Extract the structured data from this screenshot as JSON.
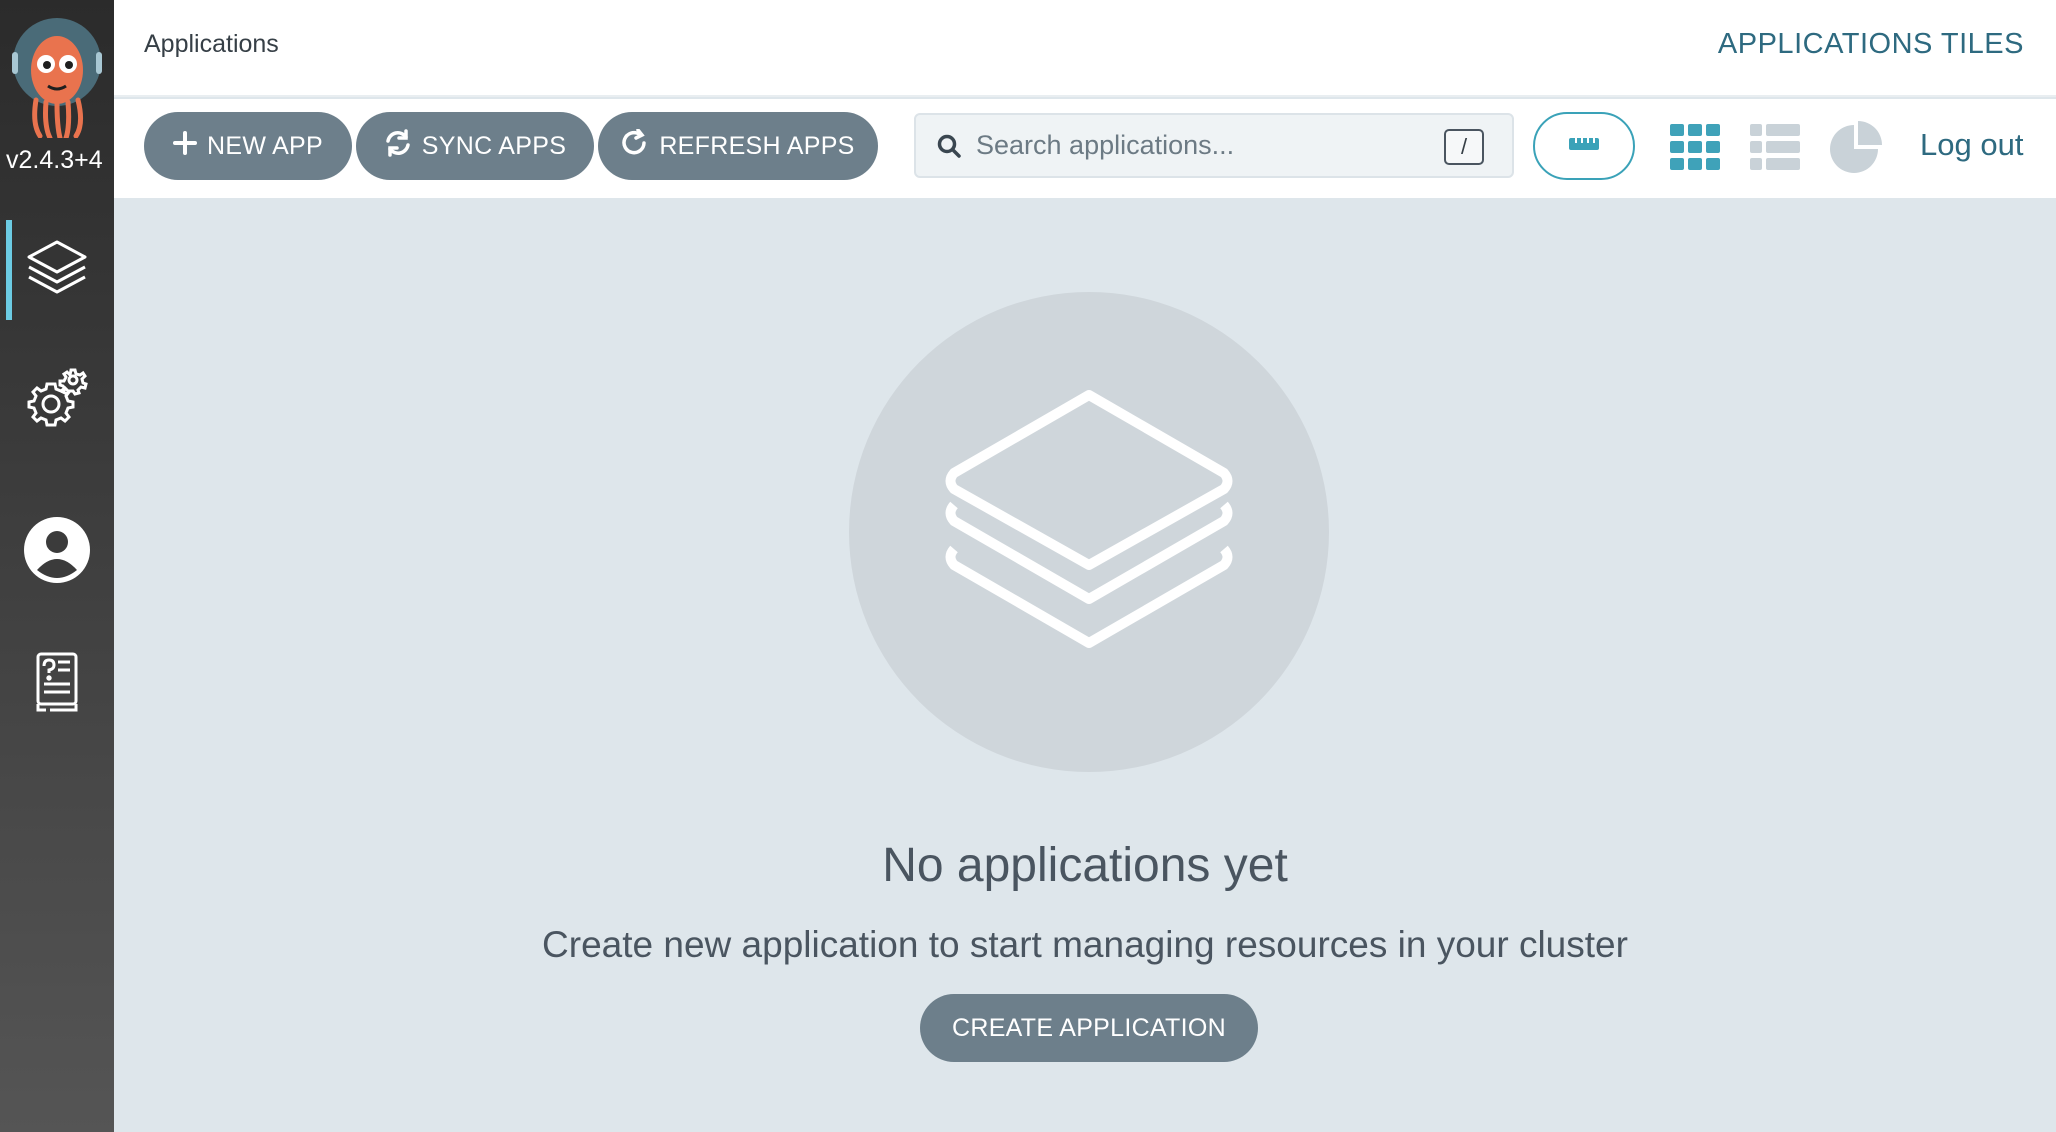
{
  "sidebar": {
    "version": "v2.4.3+4",
    "items": [
      {
        "name": "applications",
        "icon": "layers-icon",
        "active": true
      },
      {
        "name": "settings",
        "icon": "gears-icon",
        "active": false
      },
      {
        "name": "user-info",
        "icon": "user-circle-icon",
        "active": false
      },
      {
        "name": "documentation",
        "icon": "help-book-icon",
        "active": false
      }
    ]
  },
  "header": {
    "breadcrumb": "Applications",
    "title": "APPLICATIONS TILES"
  },
  "toolbar": {
    "new_app_label": "NEW APP",
    "sync_apps_label": "SYNC APPS",
    "refresh_apps_label": "REFRESH APPS",
    "search_placeholder": "Search applications...",
    "search_value": "",
    "search_shortcut": "/",
    "view_icons": [
      "tiles-view-icon",
      "list-view-icon",
      "summary-pie-icon"
    ],
    "logout_label": "Log out"
  },
  "main": {
    "empty_title": "No applications yet",
    "empty_subtitle": "Create new application to start managing resources in your cluster",
    "create_button_label": "CREATE APPLICATION"
  },
  "colors": {
    "sidebar_dark": "#2b2b2b",
    "button_bg": "#6d7f8b",
    "accent": "#2e6a80",
    "active_indicator": "#6ccbe3",
    "tiles_icon": "#3fa2b9",
    "main_bg": "#dee6eb"
  }
}
